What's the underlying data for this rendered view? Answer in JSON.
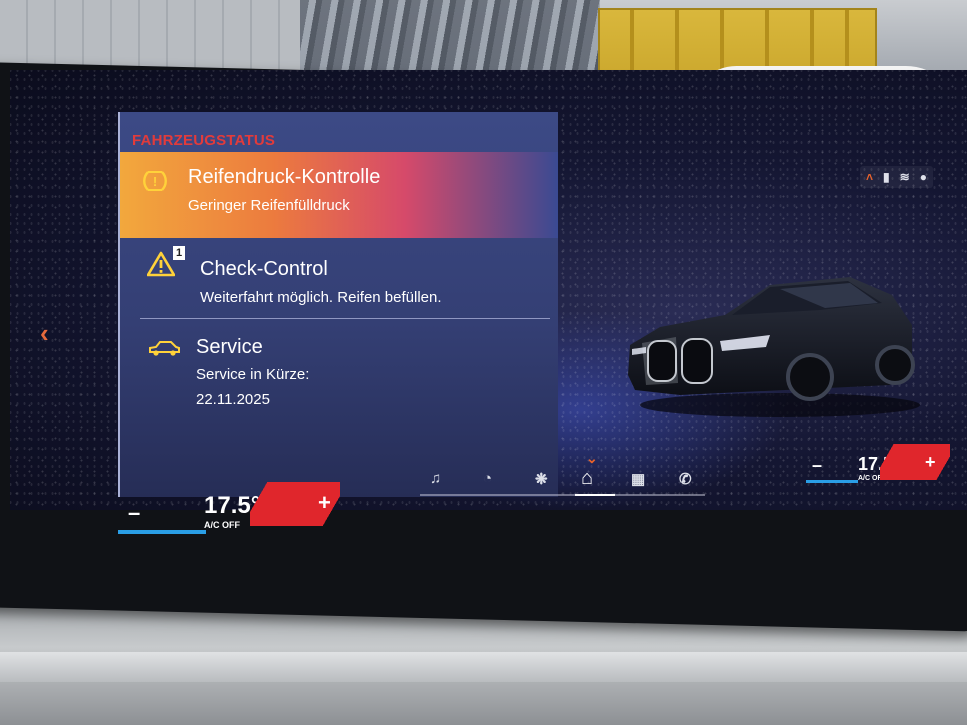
{
  "panel": {
    "title": "FAHRZEUGSTATUS",
    "items": [
      {
        "icon": "tire-pressure-warning-icon",
        "title": "Reifendruck-Kontrolle",
        "subtitle": "Geringer Reifenfülldruck",
        "color": "#f2a83d"
      },
      {
        "icon": "warning-triangle-icon",
        "badge": "1",
        "title": "Check-Control",
        "subtitle": "Weiterfahrt möglich. Reifen befüllen."
      },
      {
        "icon": "car-service-icon",
        "title": "Service",
        "subtitle": "Service in Kürze:",
        "date": "22.11.2025"
      }
    ]
  },
  "climate": {
    "left": {
      "temp": "17.5°",
      "ac_status": "A/C OFF",
      "minus": "–",
      "plus": "+"
    },
    "right": {
      "temp": "17.5°",
      "ac_status": "A/C OFF",
      "minus": "–",
      "plus": "+"
    }
  },
  "nav": {
    "items": [
      "music-icon",
      "speedometer-icon",
      "fan-icon",
      "home-icon",
      "apps-grid-icon",
      "phone-icon"
    ],
    "active": "home-icon"
  },
  "colors": {
    "accent": "#e8632c",
    "warning": "#ffd23a",
    "title_red": "#e23b3b",
    "temp_cold": "#2a9ee6",
    "temp_warm": "#e0262c"
  }
}
